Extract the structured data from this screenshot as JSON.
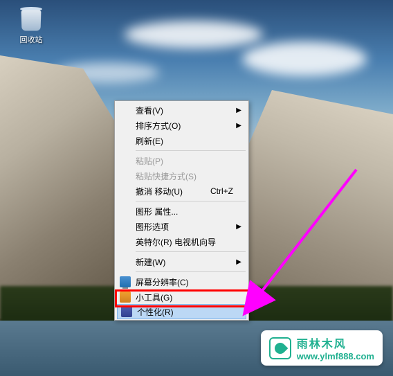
{
  "desktop": {
    "recycle_bin_label": "回收站"
  },
  "menu": {
    "view": {
      "label": "查看(V)"
    },
    "sort_by": {
      "label": "排序方式(O)"
    },
    "refresh": {
      "label": "刷新(E)"
    },
    "paste": {
      "label": "粘贴(P)"
    },
    "paste_shortcut": {
      "label": "粘贴快捷方式(S)"
    },
    "undo_move": {
      "label": "撤消 移动(U)",
      "shortcut": "Ctrl+Z"
    },
    "graphics_properties": {
      "label": "图形 属性..."
    },
    "graphics_options": {
      "label": "图形选项"
    },
    "intel_tv": {
      "label": "英特尔(R) 电视机向导"
    },
    "new": {
      "label": "新建(W)"
    },
    "screen_resolution": {
      "label": "屏幕分辨率(C)"
    },
    "gadgets": {
      "label": "小工具(G)"
    },
    "personalize": {
      "label": "个性化(R)"
    }
  },
  "watermark": {
    "title": "雨林木风",
    "url": "www.ylmf888.com"
  }
}
